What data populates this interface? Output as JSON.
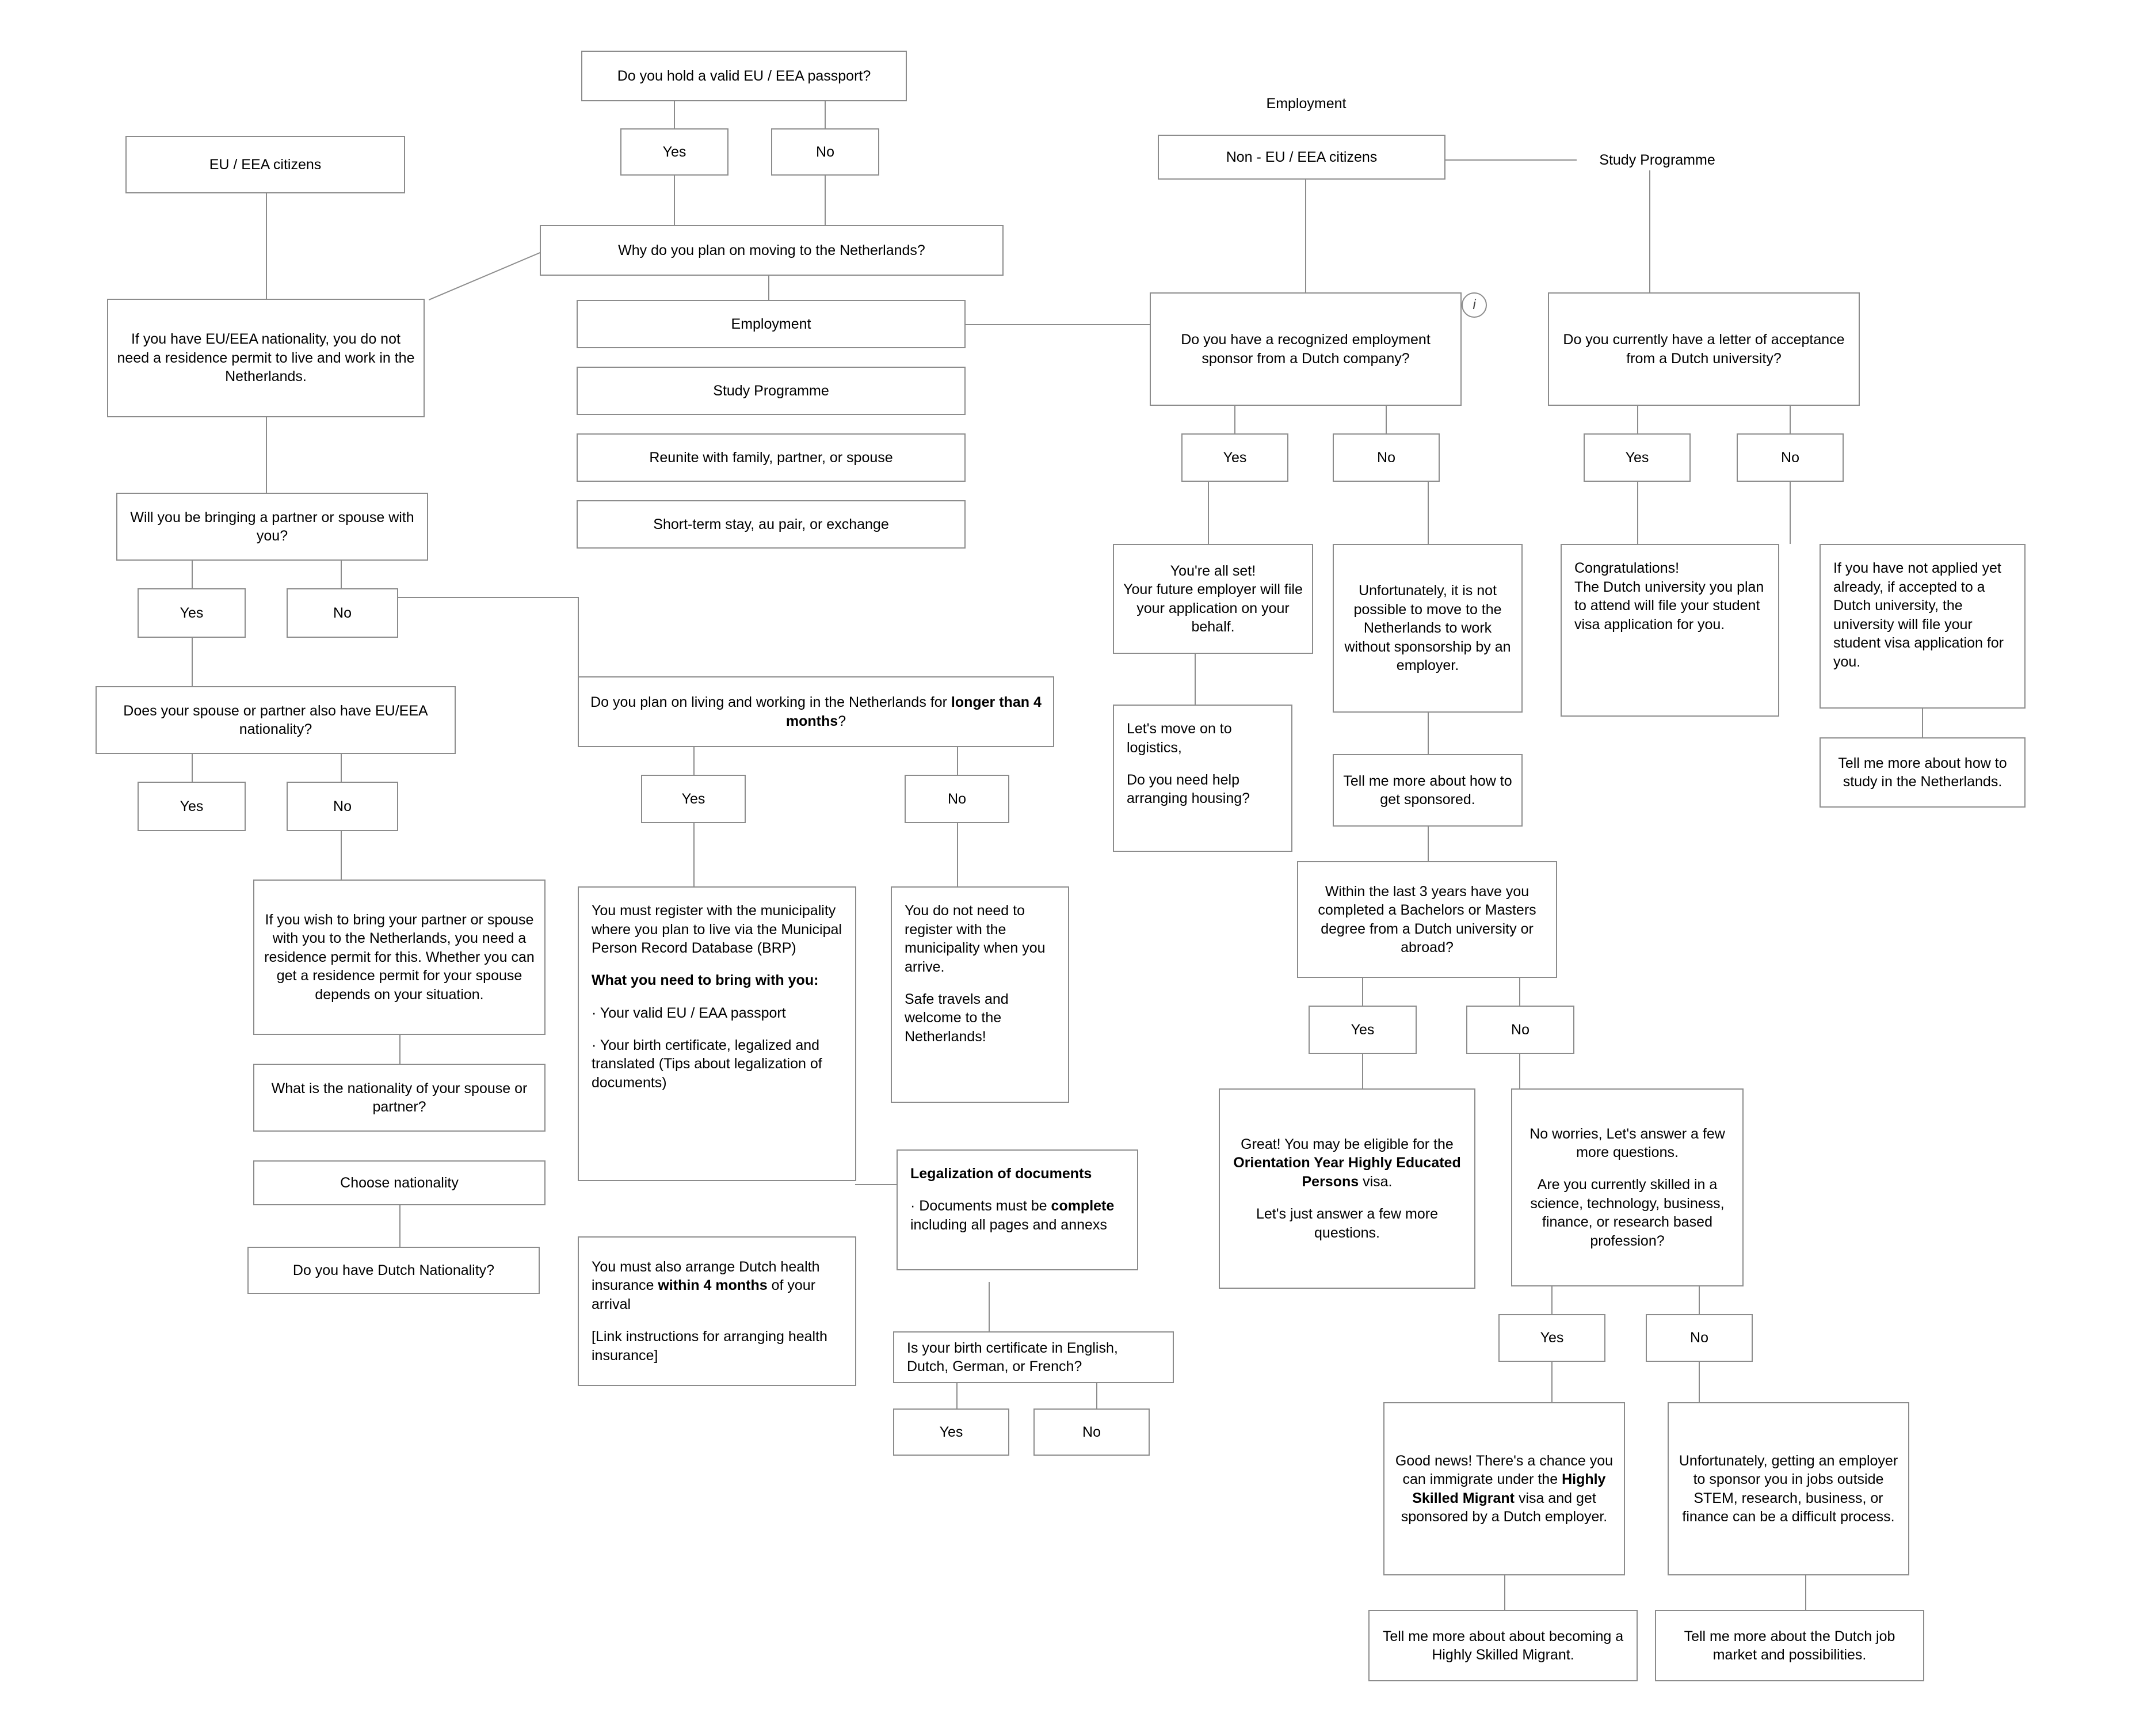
{
  "diagram": {
    "title": "Netherlands immigration decision flowchart",
    "line_color": "#8c8c8c",
    "background": "#ffffff"
  },
  "labels": {
    "employment_label": "Employment",
    "study_programme_label": "Study Programme",
    "info_icon": "info-icon"
  },
  "nodes": {
    "passport_question": "Do you hold a valid EU / EEA passport?",
    "passport_yes": "Yes",
    "passport_no": "No",
    "eu_eea_citizens": "EU / EEA citizens",
    "why_moving": "Why do you plan on moving to the Netherlands?",
    "eu_nationality_info": "If you have EU/EEA nationality, you do not need a residence permit to live and work in the Netherlands.",
    "option_employment": "Employment",
    "option_study": "Study Programme",
    "option_reunite": "Reunite with family, partner, or spouse",
    "option_short_term": "Short-term stay, au pair, or exchange",
    "bringing_partner_q": "Will you be bringing a partner or spouse with you?",
    "bringing_partner_yes": "Yes",
    "bringing_partner_no": "No",
    "spouse_eu_q": "Does your spouse or partner also have EU/EEA nationality?",
    "spouse_eu_yes": "Yes",
    "spouse_eu_no": "No",
    "bring_partner_info": "If you wish to bring your partner or spouse with you to the Netherlands, you need a residence permit for this. Whether you can get a residence permit for your spouse depends on your situation.",
    "spouse_nationality_q": "What is the nationality of your spouse or partner?",
    "choose_nationality": "Choose nationality",
    "dutch_nationality_q": "Do you have Dutch Nationality?",
    "longer_4_months_q_part1": "Do you plan on living and working in the Netherlands for ",
    "longer_4_months_q_bold": "longer than 4 months",
    "longer_4_months_q_part2": "?",
    "longer_yes": "Yes",
    "longer_no": "No",
    "register_brp_p1": "You must register with the municipality where you plan to live via the Municipal Person Record Database (BRP)",
    "register_brp_bold": "What you need to bring with you:",
    "register_brp_b1": "· Your valid EU / EAA passport",
    "register_brp_b2": "· Your birth certificate, legalized and translated  (Tips about legalization of documents)",
    "no_register_p1": "You do not need to register with the municipality when you arrive.",
    "no_register_p2": "Safe travels and welcome to the Netherlands!",
    "health_insurance_p1a": "You must also arrange Dutch health insurance ",
    "health_insurance_bold": "within 4 months",
    "health_insurance_p1b": " of your arrival",
    "health_insurance_p2": "[Link instructions for arranging health insurance]",
    "legalization_title": "Legalization of documents",
    "legalization_b1a": "· Documents must be ",
    "legalization_b1_bold": "complete",
    "legalization_b1b": " including all pages and annexs",
    "birth_cert_lang_q": "Is your birth certificate in English, Dutch, German, or French?",
    "birth_cert_yes": "Yes",
    "birth_cert_no": "No",
    "non_eu_citizens": "Non - EU / EEA citizens",
    "sponsor_q": "Do you have a recognized employment sponsor from a Dutch company?",
    "sponsor_yes": "Yes",
    "sponsor_no": "No",
    "all_set": "You're all set!\nYour future employer will  file your application on your behalf.",
    "logistics_p1": "Let's move on to logistics,",
    "logistics_p2": "Do you need help arranging housing?",
    "no_sponsorship": "Unfortunately, it is not possible to move to the Netherlands to work without sponsorship by an employer.",
    "tell_me_sponsored": "Tell me more about how to get sponsored.",
    "degree_q": "Within the last 3 years have you completed a Bachelors or Masters degree from a Dutch university or abroad?",
    "degree_yes": "Yes",
    "degree_no": "No",
    "orientation_year_p1": "Great! You may be eligible for the ",
    "orientation_year_bold": "Orientation Year Highly Educated Persons",
    "orientation_year_p1b": " visa.",
    "orientation_year_p2": "Let's just answer a few more questions.",
    "no_worries_p1": "No worries, Let's answer a few more questions.",
    "no_worries_p2": "Are you currently skilled in a science, technology, business, finance, or research based profession?",
    "skilled_yes": "Yes",
    "skilled_no": "No",
    "hsm_p1": "Good news! There's a chance you can immigrate under the ",
    "hsm_bold": "Highly Skilled Migrant",
    "hsm_p2": " visa and get sponsored by a Dutch employer.",
    "tell_me_hsm": "Tell me more about about becoming a Highly Skilled Migrant.",
    "difficult_process": "Unfortunately, getting an employer to sponsor you in jobs outside STEM, research, business, or finance can be a difficult process.",
    "tell_me_job_market": "Tell me more about the Dutch job market and possibilities.",
    "letter_acceptance_q": "Do you currently have a letter of acceptance from a Dutch university?",
    "letter_yes": "Yes",
    "letter_no": "No",
    "congratulations": "Congratulations!\nThe Dutch university you plan to attend will file your student visa application for you.",
    "not_applied_yet": "If you have not applied yet already, if accepted to a Dutch university, the university will file your student visa application for you.",
    "tell_me_study": "Tell me more about how to study in the Netherlands."
  }
}
